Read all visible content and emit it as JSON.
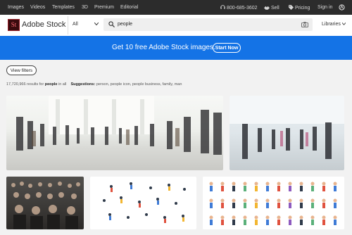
{
  "topnav": {
    "items": [
      "Images",
      "Videos",
      "Templates",
      "3D",
      "Premium",
      "Editorial"
    ],
    "phone": "800-685-3602",
    "sell": "Sell",
    "pricing": "Pricing",
    "signin": "Sign in"
  },
  "header": {
    "logo_mark": "St",
    "brand": "Adobe Stock",
    "filter": "All",
    "search_value": "people",
    "libraries": "Libraries"
  },
  "banner": {
    "text": "Get 10 free Adobe Stock images.",
    "cta": "Start Now"
  },
  "results": {
    "view_filters": "View filters",
    "count_prefix": "17,720,966 results for",
    "query": "people",
    "count_suffix": "in all",
    "suggestions_label": "Suggestions:",
    "suggestions": "person, people icon, people business, family, man"
  },
  "images": [
    {
      "description": "blurred crowd walking in bright hall"
    },
    {
      "description": "blurred business people walking"
    },
    {
      "description": "large crowd of people"
    },
    {
      "description": "illustrated people set"
    },
    {
      "description": "illustrated characters grid"
    }
  ],
  "colors": {
    "topnav_bg": "#2c2c2c",
    "banner_bg": "#1473e6",
    "logo_bg": "#3a0b0e",
    "logo_text": "#ff6b75"
  }
}
